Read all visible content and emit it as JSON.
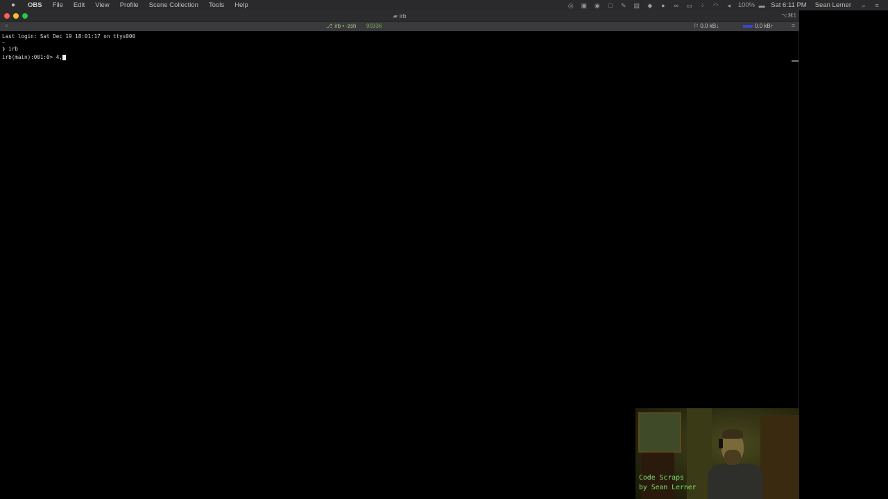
{
  "menubar": {
    "app_name": "OBS",
    "items": [
      "File",
      "Edit",
      "View",
      "Profile",
      "Scene Collection",
      "Tools",
      "Help"
    ],
    "status_icons": [
      "obs-icon",
      "screen-icon",
      "chrome-icon",
      "window-icon",
      "pen-icon",
      "clipboard-icon",
      "bird-icon",
      "record-icon",
      "glasses-icon",
      "cast-icon",
      "dots-icon",
      "wifi-icon",
      "volume-icon"
    ],
    "battery": "100%",
    "clock": "Sat 6:11 PM",
    "user": "Sean Lerner"
  },
  "window": {
    "title": "irb",
    "shortcut": "⌥⌘1"
  },
  "tabbar": {
    "tab_label": "irb • -zsh",
    "pid": "90336",
    "net_down": "0.0 kB↓",
    "net_up": "0.0 kB↑"
  },
  "terminal": {
    "last_login": "Last login: Sat Dec 19 18:01:17 on ttys000",
    "tilde": "~",
    "prompt_arrow": "❯",
    "command": "irb",
    "irb_prompt": "irb(main):001:0>",
    "irb_input": "4,"
  },
  "webcam": {
    "caption_line1": "Code Scraps",
    "caption_line2": "by Sean Lerner"
  },
  "colors": {
    "close": "#ff5f57",
    "minimize": "#febc2e",
    "maximize": "#28c840",
    "caption": "#7de070"
  }
}
